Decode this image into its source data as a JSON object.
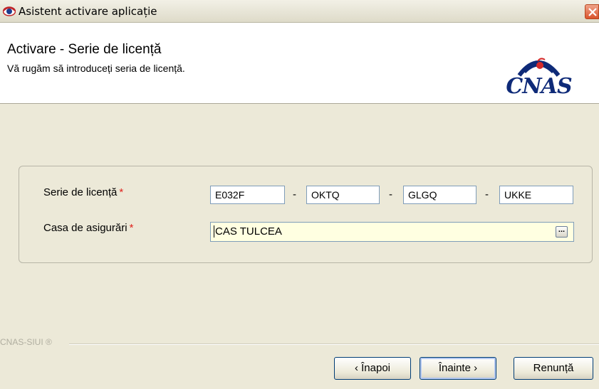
{
  "window": {
    "title": "Asistent activare aplicație"
  },
  "header": {
    "title": "Activare - Serie de licență",
    "subtitle": "Vă rugăm să introduceți seria de licență.",
    "logo_text": "CNAS"
  },
  "form": {
    "license_label": "Serie de licență",
    "required_mark": "*",
    "license_parts": [
      "E032F",
      "OKTQ",
      "GLGQ",
      "UKKE"
    ],
    "separator": "-",
    "insurance_label": "Casa de asigurări",
    "insurance_value": "CAS TULCEA",
    "browse_label": "..."
  },
  "footer": {
    "label": "CNAS-SIUI ®",
    "back_label": "‹ Înapoi",
    "next_label": "Înainte ›",
    "cancel_label": "Renunță"
  },
  "colors": {
    "accent": "#0e2a78",
    "required": "#e0231d",
    "combo_bg": "#ffffe1"
  }
}
